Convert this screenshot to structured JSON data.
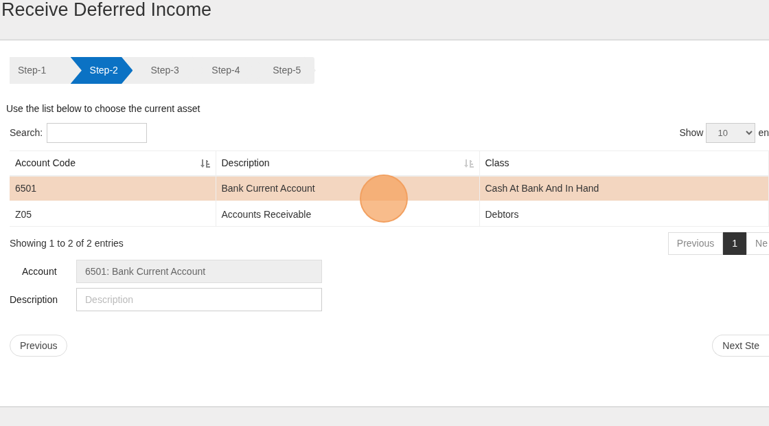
{
  "page": {
    "title": "Receive Deferred Income"
  },
  "steps": [
    {
      "label": "Step-1",
      "selected": false
    },
    {
      "label": "Step-2",
      "selected": true
    },
    {
      "label": "Step-3",
      "selected": false
    },
    {
      "label": "Step-4",
      "selected": false
    },
    {
      "label": "Step-5",
      "selected": false
    }
  ],
  "instruction": "Use the list below to choose the current asset",
  "search": {
    "label": "Search:"
  },
  "length_menu": {
    "label": "Show",
    "value": "10",
    "suffix": "en"
  },
  "table": {
    "columns": [
      {
        "label": "Account Code",
        "sorted": true
      },
      {
        "label": "Description",
        "sorted": false
      },
      {
        "label": "Class"
      }
    ],
    "rows": [
      {
        "cells": [
          "6501",
          "Bank Current Account",
          "Cash At Bank And In Hand"
        ],
        "selected": true
      },
      {
        "cells": [
          "Z05",
          "Accounts Receivable",
          "Debtors"
        ],
        "selected": false
      }
    ]
  },
  "info": "Showing 1 to 2 of 2 entries",
  "pagination": [
    {
      "label": "Previous",
      "selected": false
    },
    {
      "label": "1",
      "selected": true
    },
    {
      "label": "Ne",
      "selected": false
    }
  ],
  "form": [
    {
      "label": "Account",
      "value": "6501: Bank Current Account",
      "disabled": true
    },
    {
      "label": "Description",
      "placeholder": "Description",
      "disabled": false
    }
  ],
  "buttons": [
    {
      "label": "Previous"
    },
    {
      "label": "Next Ste"
    }
  ]
}
